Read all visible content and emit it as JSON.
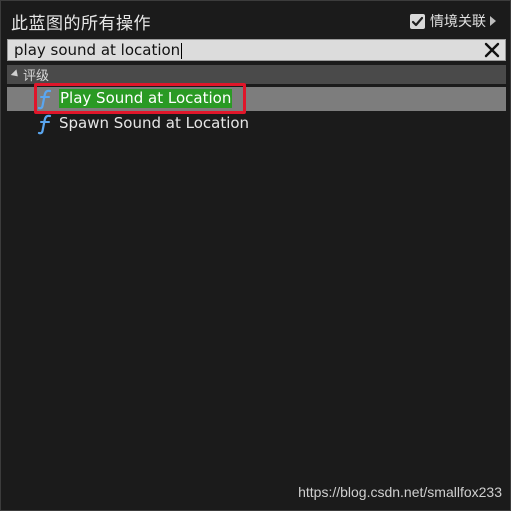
{
  "header": {
    "title": "此蓝图的所有操作",
    "context_label": "情境关联",
    "context_checked": true
  },
  "search": {
    "value": "play sound at location",
    "clear_icon": "close-icon"
  },
  "category": {
    "label": "评级"
  },
  "results": [
    {
      "label": "Play Sound at Location",
      "icon": "function-icon",
      "selected": true
    },
    {
      "label": "Spawn Sound at Location",
      "icon": "function-icon",
      "selected": false
    }
  ],
  "watermark": "https://blog.csdn.net/smallfox233",
  "colors": {
    "panel_bg": "#1b1b1b",
    "highlight": "#2a9a24",
    "selection": "#7d7d7d",
    "annotation": "#e0162a"
  }
}
